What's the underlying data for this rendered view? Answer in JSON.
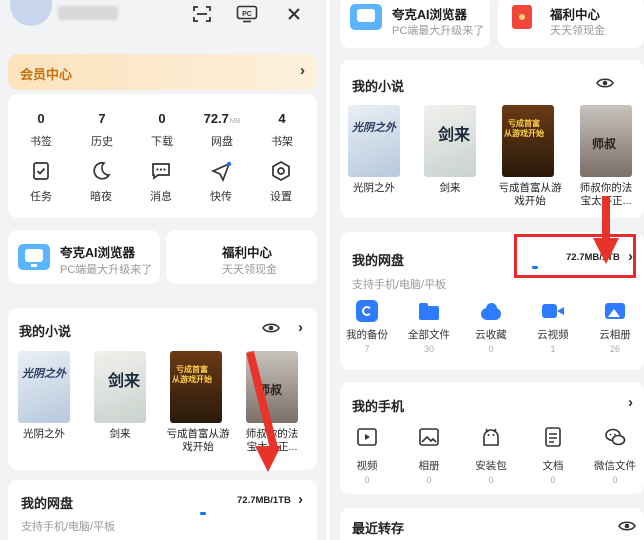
{
  "left": {
    "member_center": "会员中心",
    "stats": [
      {
        "num": "0",
        "label": "书签"
      },
      {
        "num": "7",
        "label": "历史"
      },
      {
        "num": "0",
        "label": "下载"
      },
      {
        "num": "72.7",
        "unit": "MB",
        "label": "网盘"
      },
      {
        "num": "4",
        "label": "书架"
      }
    ],
    "tools": [
      {
        "label": "任务",
        "icon": "task-icon"
      },
      {
        "label": "暗夜",
        "icon": "moon-icon"
      },
      {
        "label": "消息",
        "icon": "message-icon"
      },
      {
        "label": "快传",
        "icon": "send-icon"
      },
      {
        "label": "设置",
        "icon": "settings-icon"
      }
    ],
    "browser_title": "夸克AI浏览器",
    "browser_sub": "PC端最大升级来了",
    "welfare_title": "福利中心",
    "welfare_sub": "天天领现金",
    "novels_title": "我的小说",
    "books": [
      {
        "title": "光阴之外",
        "cover_text": "光阴之外"
      },
      {
        "title": "剑来",
        "cover_text": "剑来"
      },
      {
        "title": "亏成首富从游戏开始",
        "cover_text": "亏成首富从游戏开始"
      },
      {
        "title": "师叔你的法宝太不正...",
        "cover_text": "师叔"
      }
    ],
    "disk_title": "我的网盘",
    "disk_usage": "72.7MB/1TB",
    "disk_sub": "支持手机/电脑/平板"
  },
  "right": {
    "browser_title": "夸克AI浏览器",
    "browser_sub": "PC端最大升级来了",
    "welfare_title": "福利中心",
    "welfare_sub": "天天领现金",
    "novels_title": "我的小说",
    "books": [
      {
        "title": "光阴之外",
        "cover_text": "光阴之外"
      },
      {
        "title": "剑来",
        "cover_text": "剑来"
      },
      {
        "title": "亏成首富从游戏开始",
        "cover_text": "亏成首富从游戏开始"
      },
      {
        "title": "师叔你的法宝太不正...",
        "cover_text": "师叔"
      }
    ],
    "disk_title": "我的网盘",
    "disk_usage": "72.7MB/1TB",
    "disk_sub": "支持手机/电脑/平板",
    "disk_items": [
      {
        "label": "我的备份",
        "count": "7"
      },
      {
        "label": "全部文件",
        "count": "30"
      },
      {
        "label": "云收藏",
        "count": "0"
      },
      {
        "label": "云视频",
        "count": "1"
      },
      {
        "label": "云相册",
        "count": "26"
      }
    ],
    "phone_title": "我的手机",
    "phone_items": [
      {
        "label": "视频",
        "count": "0"
      },
      {
        "label": "相册",
        "count": "0"
      },
      {
        "label": "安装包",
        "count": "0"
      },
      {
        "label": "文档",
        "count": "0"
      },
      {
        "label": "微信文件",
        "count": "0"
      }
    ],
    "recent_title": "最近转存"
  },
  "colors": {
    "accent_blue": "#1f6fff",
    "annotation_red": "#e52b2b",
    "member_gold": "#c8700f"
  }
}
